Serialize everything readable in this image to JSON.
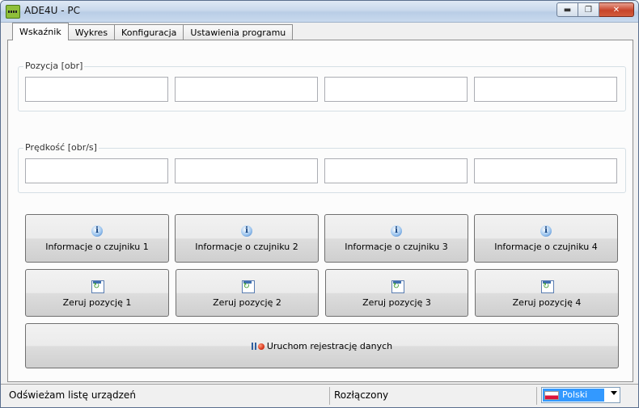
{
  "window": {
    "title": "ADE4U - PC",
    "min": "▬",
    "max": "❐",
    "close": "✕"
  },
  "tabs": [
    {
      "label": "Wskaźnik",
      "active": true
    },
    {
      "label": "Wykres",
      "active": false
    },
    {
      "label": "Konfiguracja",
      "active": false
    },
    {
      "label": "Ustawienia programu",
      "active": false
    }
  ],
  "position_group": {
    "label": "Pozycja [obr]",
    "values": [
      "",
      "",
      "",
      ""
    ]
  },
  "speed_group": {
    "label": "Prędkość [obr/s]",
    "values": [
      "",
      "",
      "",
      ""
    ]
  },
  "info_buttons": [
    {
      "label": "Informacje o czujniku 1",
      "icon": "info-icon"
    },
    {
      "label": "Informacje o czujniku 2",
      "icon": "info-icon"
    },
    {
      "label": "Informacje o czujniku 3",
      "icon": "info-icon"
    },
    {
      "label": "Informacje o czujniku 4",
      "icon": "info-icon"
    }
  ],
  "reset_buttons": [
    {
      "label": "Zeruj pozycję 1",
      "icon": "refresh-icon"
    },
    {
      "label": "Zeruj pozycję 2",
      "icon": "refresh-icon"
    },
    {
      "label": "Zeruj pozycję 3",
      "icon": "refresh-icon"
    },
    {
      "label": "Zeruj pozycję 4",
      "icon": "refresh-icon"
    }
  ],
  "record_button": {
    "label": "Uruchom rejestrację danych",
    "icon": "pause-record-icon"
  },
  "status": {
    "left": "Odświeżam listę urządzeń",
    "connection": "Rozłączony",
    "language": "Polski"
  }
}
